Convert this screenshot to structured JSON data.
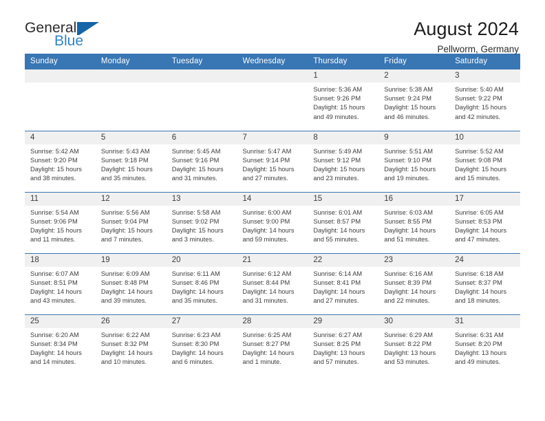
{
  "brand": {
    "name_top": "General",
    "name_bottom": "Blue",
    "logo_icon": "blue-flag-triangle-icon",
    "accent_color": "#2f83c8",
    "logo_color": "#1565a8"
  },
  "header": {
    "title": "August 2024",
    "subtitle": "Pellworm, Germany",
    "header_bg_color": "#3876b4",
    "header_text_color": "#ffffff",
    "daynum_bg_color": "#f0f0f0"
  },
  "calendar": {
    "weekday_headers": [
      "Sunday",
      "Monday",
      "Tuesday",
      "Wednesday",
      "Thursday",
      "Friday",
      "Saturday"
    ],
    "labels": {
      "sunrise": "Sunrise:",
      "sunset": "Sunset:",
      "daylight": "Daylight:"
    },
    "weeks": [
      [
        {
          "day": "",
          "sunrise": "",
          "sunset": "",
          "daylight_line1": "",
          "daylight_line2": "",
          "empty": true
        },
        {
          "day": "",
          "sunrise": "",
          "sunset": "",
          "daylight_line1": "",
          "daylight_line2": "",
          "empty": true
        },
        {
          "day": "",
          "sunrise": "",
          "sunset": "",
          "daylight_line1": "",
          "daylight_line2": "",
          "empty": true
        },
        {
          "day": "",
          "sunrise": "",
          "sunset": "",
          "daylight_line1": "",
          "daylight_line2": "",
          "empty": true
        },
        {
          "day": "1",
          "sunrise": "Sunrise: 5:36 AM",
          "sunset": "Sunset: 9:26 PM",
          "daylight_line1": "Daylight: 15 hours",
          "daylight_line2": "and 49 minutes."
        },
        {
          "day": "2",
          "sunrise": "Sunrise: 5:38 AM",
          "sunset": "Sunset: 9:24 PM",
          "daylight_line1": "Daylight: 15 hours",
          "daylight_line2": "and 46 minutes."
        },
        {
          "day": "3",
          "sunrise": "Sunrise: 5:40 AM",
          "sunset": "Sunset: 9:22 PM",
          "daylight_line1": "Daylight: 15 hours",
          "daylight_line2": "and 42 minutes."
        }
      ],
      [
        {
          "day": "4",
          "sunrise": "Sunrise: 5:42 AM",
          "sunset": "Sunset: 9:20 PM",
          "daylight_line1": "Daylight: 15 hours",
          "daylight_line2": "and 38 minutes."
        },
        {
          "day": "5",
          "sunrise": "Sunrise: 5:43 AM",
          "sunset": "Sunset: 9:18 PM",
          "daylight_line1": "Daylight: 15 hours",
          "daylight_line2": "and 35 minutes."
        },
        {
          "day": "6",
          "sunrise": "Sunrise: 5:45 AM",
          "sunset": "Sunset: 9:16 PM",
          "daylight_line1": "Daylight: 15 hours",
          "daylight_line2": "and 31 minutes."
        },
        {
          "day": "7",
          "sunrise": "Sunrise: 5:47 AM",
          "sunset": "Sunset: 9:14 PM",
          "daylight_line1": "Daylight: 15 hours",
          "daylight_line2": "and 27 minutes."
        },
        {
          "day": "8",
          "sunrise": "Sunrise: 5:49 AM",
          "sunset": "Sunset: 9:12 PM",
          "daylight_line1": "Daylight: 15 hours",
          "daylight_line2": "and 23 minutes."
        },
        {
          "day": "9",
          "sunrise": "Sunrise: 5:51 AM",
          "sunset": "Sunset: 9:10 PM",
          "daylight_line1": "Daylight: 15 hours",
          "daylight_line2": "and 19 minutes."
        },
        {
          "day": "10",
          "sunrise": "Sunrise: 5:52 AM",
          "sunset": "Sunset: 9:08 PM",
          "daylight_line1": "Daylight: 15 hours",
          "daylight_line2": "and 15 minutes."
        }
      ],
      [
        {
          "day": "11",
          "sunrise": "Sunrise: 5:54 AM",
          "sunset": "Sunset: 9:06 PM",
          "daylight_line1": "Daylight: 15 hours",
          "daylight_line2": "and 11 minutes."
        },
        {
          "day": "12",
          "sunrise": "Sunrise: 5:56 AM",
          "sunset": "Sunset: 9:04 PM",
          "daylight_line1": "Daylight: 15 hours",
          "daylight_line2": "and 7 minutes."
        },
        {
          "day": "13",
          "sunrise": "Sunrise: 5:58 AM",
          "sunset": "Sunset: 9:02 PM",
          "daylight_line1": "Daylight: 15 hours",
          "daylight_line2": "and 3 minutes."
        },
        {
          "day": "14",
          "sunrise": "Sunrise: 6:00 AM",
          "sunset": "Sunset: 9:00 PM",
          "daylight_line1": "Daylight: 14 hours",
          "daylight_line2": "and 59 minutes."
        },
        {
          "day": "15",
          "sunrise": "Sunrise: 6:01 AM",
          "sunset": "Sunset: 8:57 PM",
          "daylight_line1": "Daylight: 14 hours",
          "daylight_line2": "and 55 minutes."
        },
        {
          "day": "16",
          "sunrise": "Sunrise: 6:03 AM",
          "sunset": "Sunset: 8:55 PM",
          "daylight_line1": "Daylight: 14 hours",
          "daylight_line2": "and 51 minutes."
        },
        {
          "day": "17",
          "sunrise": "Sunrise: 6:05 AM",
          "sunset": "Sunset: 8:53 PM",
          "daylight_line1": "Daylight: 14 hours",
          "daylight_line2": "and 47 minutes."
        }
      ],
      [
        {
          "day": "18",
          "sunrise": "Sunrise: 6:07 AM",
          "sunset": "Sunset: 8:51 PM",
          "daylight_line1": "Daylight: 14 hours",
          "daylight_line2": "and 43 minutes."
        },
        {
          "day": "19",
          "sunrise": "Sunrise: 6:09 AM",
          "sunset": "Sunset: 8:48 PM",
          "daylight_line1": "Daylight: 14 hours",
          "daylight_line2": "and 39 minutes."
        },
        {
          "day": "20",
          "sunrise": "Sunrise: 6:11 AM",
          "sunset": "Sunset: 8:46 PM",
          "daylight_line1": "Daylight: 14 hours",
          "daylight_line2": "and 35 minutes."
        },
        {
          "day": "21",
          "sunrise": "Sunrise: 6:12 AM",
          "sunset": "Sunset: 8:44 PM",
          "daylight_line1": "Daylight: 14 hours",
          "daylight_line2": "and 31 minutes."
        },
        {
          "day": "22",
          "sunrise": "Sunrise: 6:14 AM",
          "sunset": "Sunset: 8:41 PM",
          "daylight_line1": "Daylight: 14 hours",
          "daylight_line2": "and 27 minutes."
        },
        {
          "day": "23",
          "sunrise": "Sunrise: 6:16 AM",
          "sunset": "Sunset: 8:39 PM",
          "daylight_line1": "Daylight: 14 hours",
          "daylight_line2": "and 22 minutes."
        },
        {
          "day": "24",
          "sunrise": "Sunrise: 6:18 AM",
          "sunset": "Sunset: 8:37 PM",
          "daylight_line1": "Daylight: 14 hours",
          "daylight_line2": "and 18 minutes."
        }
      ],
      [
        {
          "day": "25",
          "sunrise": "Sunrise: 6:20 AM",
          "sunset": "Sunset: 8:34 PM",
          "daylight_line1": "Daylight: 14 hours",
          "daylight_line2": "and 14 minutes."
        },
        {
          "day": "26",
          "sunrise": "Sunrise: 6:22 AM",
          "sunset": "Sunset: 8:32 PM",
          "daylight_line1": "Daylight: 14 hours",
          "daylight_line2": "and 10 minutes."
        },
        {
          "day": "27",
          "sunrise": "Sunrise: 6:23 AM",
          "sunset": "Sunset: 8:30 PM",
          "daylight_line1": "Daylight: 14 hours",
          "daylight_line2": "and 6 minutes."
        },
        {
          "day": "28",
          "sunrise": "Sunrise: 6:25 AM",
          "sunset": "Sunset: 8:27 PM",
          "daylight_line1": "Daylight: 14 hours",
          "daylight_line2": "and 1 minute."
        },
        {
          "day": "29",
          "sunrise": "Sunrise: 6:27 AM",
          "sunset": "Sunset: 8:25 PM",
          "daylight_line1": "Daylight: 13 hours",
          "daylight_line2": "and 57 minutes."
        },
        {
          "day": "30",
          "sunrise": "Sunrise: 6:29 AM",
          "sunset": "Sunset: 8:22 PM",
          "daylight_line1": "Daylight: 13 hours",
          "daylight_line2": "and 53 minutes."
        },
        {
          "day": "31",
          "sunrise": "Sunrise: 6:31 AM",
          "sunset": "Sunset: 8:20 PM",
          "daylight_line1": "Daylight: 13 hours",
          "daylight_line2": "and 49 minutes."
        }
      ]
    ]
  }
}
